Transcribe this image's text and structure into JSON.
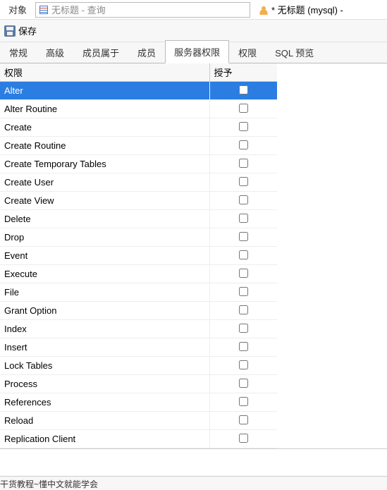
{
  "top": {
    "object_label": "对象",
    "search_placeholder": "无标题 - 查询",
    "title": "* 无标题 (mysql) - "
  },
  "toolbar": {
    "save_label": "保存"
  },
  "tabs": [
    {
      "label": "常规"
    },
    {
      "label": "高级"
    },
    {
      "label": "成员属于"
    },
    {
      "label": "成员"
    },
    {
      "label": "服务器权限"
    },
    {
      "label": "权限"
    },
    {
      "label": "SQL 预览"
    }
  ],
  "active_tab_index": 4,
  "table": {
    "headers": {
      "name": "权限",
      "grant": "授予"
    },
    "rows": [
      {
        "name": "Alter",
        "checked": false,
        "selected": true
      },
      {
        "name": "Alter Routine",
        "checked": false
      },
      {
        "name": "Create",
        "checked": false
      },
      {
        "name": "Create Routine",
        "checked": false
      },
      {
        "name": "Create Temporary Tables",
        "checked": false
      },
      {
        "name": "Create User",
        "checked": false
      },
      {
        "name": "Create View",
        "checked": false
      },
      {
        "name": "Delete",
        "checked": false
      },
      {
        "name": "Drop",
        "checked": false
      },
      {
        "name": "Event",
        "checked": false
      },
      {
        "name": "Execute",
        "checked": false
      },
      {
        "name": "File",
        "checked": false
      },
      {
        "name": "Grant Option",
        "checked": false
      },
      {
        "name": "Index",
        "checked": false
      },
      {
        "name": "Insert",
        "checked": false
      },
      {
        "name": "Lock Tables",
        "checked": false
      },
      {
        "name": "Process",
        "checked": false
      },
      {
        "name": "References",
        "checked": false
      },
      {
        "name": "Reload",
        "checked": false
      },
      {
        "name": "Replication Client",
        "checked": false
      }
    ]
  },
  "footer": {
    "text": "干货教程~懂中文就能学会"
  }
}
